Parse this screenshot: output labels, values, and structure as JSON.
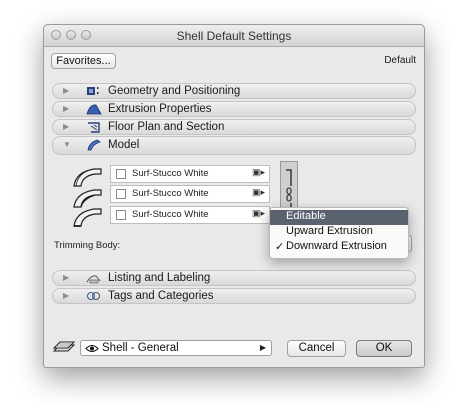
{
  "window": {
    "title": "Shell Default Settings"
  },
  "header": {
    "favorites_label": "Favorites...",
    "default_label": "Default"
  },
  "sections": [
    {
      "label": "Geometry and Positioning",
      "icon": "geometry-icon",
      "expanded": false
    },
    {
      "label": "Extrusion Properties",
      "icon": "extrusion-icon",
      "expanded": false
    },
    {
      "label": "Floor Plan and Section",
      "icon": "floor-plan-icon",
      "expanded": false
    },
    {
      "label": "Model",
      "icon": "model-icon",
      "expanded": true
    },
    {
      "label": "Listing and Labeling",
      "icon": "listing-icon",
      "expanded": false
    },
    {
      "label": "Tags and Categories",
      "icon": "tags-icon",
      "expanded": false
    }
  ],
  "model": {
    "materials": [
      {
        "label": "Surf-Stucco White",
        "checked": false
      },
      {
        "label": "Surf-Stucco White",
        "checked": false
      },
      {
        "label": "Surf-Stucco White",
        "checked": false
      }
    ],
    "trimming_label": "Trimming Body:"
  },
  "dropdown_menu": {
    "items": [
      {
        "label": "Editable",
        "checked": false,
        "highlighted": true
      },
      {
        "label": "Upward Extrusion",
        "checked": false,
        "highlighted": false
      },
      {
        "label": "Downward Extrusion",
        "checked": true,
        "highlighted": false
      }
    ],
    "check_mark": "✓",
    "highlight_color": "#5a6270"
  },
  "footer": {
    "layer_popup_label": "Shell - General",
    "cancel_label": "Cancel",
    "ok_label": "OK"
  }
}
